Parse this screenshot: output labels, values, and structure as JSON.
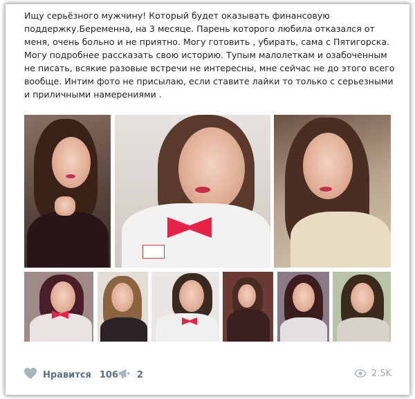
{
  "post": {
    "text": "Ищу серьёзного мужчину! Который будет оказывать финансовую поддержку.Беременна, на 3 месяце. Парень которого любила отказался от меня, очень больно и не приятно. Могу готовить , убирать, сама с Пятигорска. Могу подробнее рассказать свою историю. Тупым малолеткам и озабоченным не писать, всякие разовые встречи не интересны, мне сейчас не до этого всего вообще. Интим фото не присылаю, если ставите лайки то только с серьезными и приличными намерениями ."
  },
  "photos": {
    "large": [
      {
        "name": "photo-1",
        "bg": "#6b5a50",
        "hair": "#3a2218",
        "body": "#2a1418"
      },
      {
        "name": "photo-2",
        "bg": "#d9d4d0",
        "hair": "#5a3a2a",
        "body": "#f4f2f0"
      },
      {
        "name": "photo-3",
        "bg": "#c7b7a6",
        "hair": "#4a2e22",
        "body": "#e8dcc4"
      }
    ],
    "small": [
      {
        "name": "photo-4",
        "bg": "#a08a88",
        "hair": "#4a1e28",
        "body": "#e9e3e2"
      },
      {
        "name": "photo-5",
        "bg": "#e3ddd6",
        "hair": "#8a6440",
        "body": "#2a2226"
      },
      {
        "name": "photo-6",
        "bg": "#e9e6e3",
        "hair": "#3a2a22",
        "body": "#f2f0ee"
      },
      {
        "name": "photo-7",
        "bg": "#6a3a34",
        "hair": "#4a2a22",
        "body": "#3a2020"
      },
      {
        "name": "photo-8",
        "bg": "#8a7a88",
        "hair": "#3a1e1e",
        "body": "#e4e0e2"
      },
      {
        "name": "photo-9",
        "bg": "#b8c4a8",
        "hair": "#3a2a1e",
        "body": "#d8d4cc"
      }
    ]
  },
  "footer": {
    "like_label": "Нравится",
    "like_count": "106",
    "share_count": "2",
    "views_count": "2.5K"
  },
  "icons": {
    "like": "heart-icon",
    "share": "megaphone-icon",
    "views": "eye-icon"
  },
  "colors": {
    "accent_text": "#5d6e83",
    "icon": "#aab4c0",
    "muted": "#9aa5b2"
  }
}
